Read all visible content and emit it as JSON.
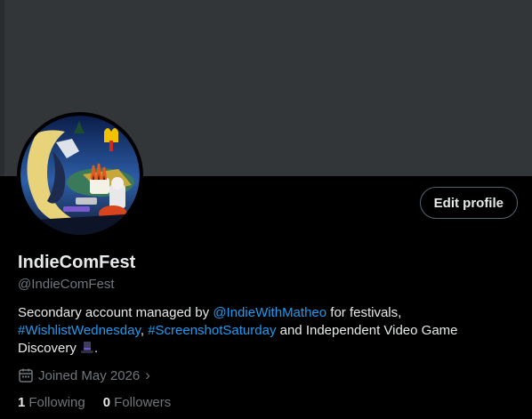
{
  "colors": {
    "background": "#000000",
    "banner": "#333639",
    "text_primary": "#e7e9ea",
    "text_secondary": "#71767b",
    "link": "#1d9bf0",
    "button_border": "#536471"
  },
  "profile": {
    "display_name": "IndieComFest",
    "handle": "@IndieComFest",
    "edit_button_label": "Edit profile",
    "bio": {
      "part1": "Secondary account managed by ",
      "mention": "@IndieWithMatheo",
      "part2": " for festivals,",
      "hashtag1": "#WishlistWednesday",
      "sep": ", ",
      "hashtag2": "#ScreenshotSaturday",
      "part3": " and Independent Video Game Discovery ",
      "emoji_icon": "top-hat-icon",
      "end": "."
    },
    "joined": {
      "icon": "calendar-icon",
      "text": "Joined May 2026",
      "chevron": "chevron-right-icon"
    },
    "stats": {
      "following_count": "1",
      "following_label": "Following",
      "followers_count": "0",
      "followers_label": "Followers"
    }
  }
}
